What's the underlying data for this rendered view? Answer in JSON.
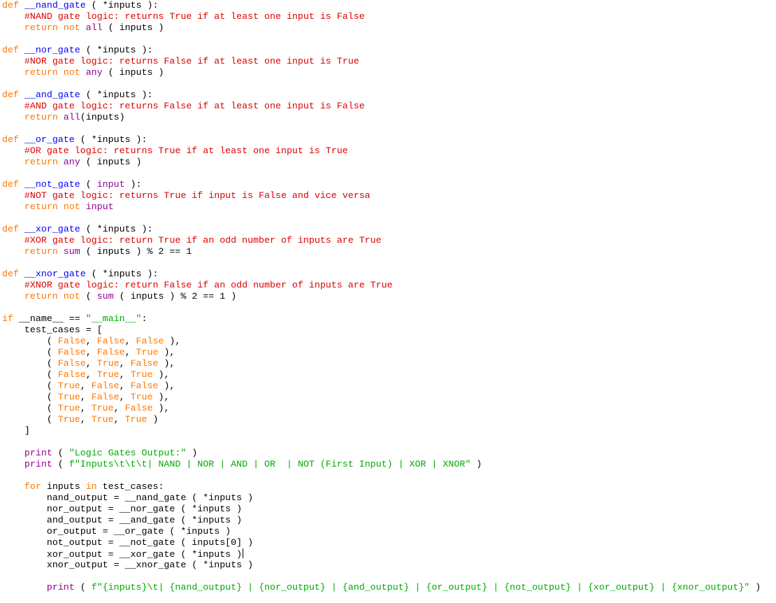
{
  "editor": {
    "language": "python",
    "colors": {
      "keyword": "#ff7700",
      "builtin": "#900090",
      "defname": "#0000ff",
      "comment": "#dd0000",
      "string": "#00aa00",
      "text": "#000000",
      "background": "#ffffff"
    },
    "lines": [
      [
        [
          "keyword",
          "def "
        ],
        [
          "defname",
          "__nand_gate"
        ],
        [
          "plain",
          " ( *inputs ):"
        ]
      ],
      [
        [
          "plain",
          "    "
        ],
        [
          "comment",
          "#NAND gate logic: returns True if at least one input is False"
        ]
      ],
      [
        [
          "plain",
          "    "
        ],
        [
          "keyword",
          "return not "
        ],
        [
          "builtin",
          "all"
        ],
        [
          "plain",
          " ( inputs )"
        ]
      ],
      [],
      [
        [
          "keyword",
          "def "
        ],
        [
          "defname",
          "__nor_gate"
        ],
        [
          "plain",
          " ( *inputs ):"
        ]
      ],
      [
        [
          "plain",
          "    "
        ],
        [
          "comment",
          "#NOR gate logic: returns False if at least one input is True"
        ]
      ],
      [
        [
          "plain",
          "    "
        ],
        [
          "keyword",
          "return not "
        ],
        [
          "builtin",
          "any"
        ],
        [
          "plain",
          " ( inputs )"
        ]
      ],
      [],
      [
        [
          "keyword",
          "def "
        ],
        [
          "defname",
          "__and_gate"
        ],
        [
          "plain",
          " ( *inputs ):"
        ]
      ],
      [
        [
          "plain",
          "    "
        ],
        [
          "comment",
          "#AND gate logic: returns False if at least one input is False"
        ]
      ],
      [
        [
          "plain",
          "    "
        ],
        [
          "keyword",
          "return "
        ],
        [
          "builtin",
          "all"
        ],
        [
          "plain",
          "(inputs)"
        ]
      ],
      [],
      [
        [
          "keyword",
          "def "
        ],
        [
          "defname",
          "__or_gate"
        ],
        [
          "plain",
          " ( *inputs ):"
        ]
      ],
      [
        [
          "plain",
          "    "
        ],
        [
          "comment",
          "#OR gate logic: returns True if at least one input is True"
        ]
      ],
      [
        [
          "plain",
          "    "
        ],
        [
          "keyword",
          "return "
        ],
        [
          "builtin",
          "any"
        ],
        [
          "plain",
          " ( inputs )"
        ]
      ],
      [],
      [
        [
          "keyword",
          "def "
        ],
        [
          "defname",
          "__not_gate"
        ],
        [
          "plain",
          " ( "
        ],
        [
          "builtin",
          "input"
        ],
        [
          "plain",
          " ):"
        ]
      ],
      [
        [
          "plain",
          "    "
        ],
        [
          "comment",
          "#NOT gate logic: returns True if input is False and vice versa"
        ]
      ],
      [
        [
          "plain",
          "    "
        ],
        [
          "keyword",
          "return not "
        ],
        [
          "builtin",
          "input"
        ]
      ],
      [],
      [
        [
          "keyword",
          "def "
        ],
        [
          "defname",
          "__xor_gate"
        ],
        [
          "plain",
          " ( *inputs ):"
        ]
      ],
      [
        [
          "plain",
          "    "
        ],
        [
          "comment",
          "#XOR gate logic: return True if an odd number of inputs are True"
        ]
      ],
      [
        [
          "plain",
          "    "
        ],
        [
          "keyword",
          "return "
        ],
        [
          "builtin",
          "sum"
        ],
        [
          "plain",
          " ( inputs ) % 2 == 1"
        ]
      ],
      [],
      [
        [
          "keyword",
          "def "
        ],
        [
          "defname",
          "__xnor_gate"
        ],
        [
          "plain",
          " ( *inputs ):"
        ]
      ],
      [
        [
          "plain",
          "    "
        ],
        [
          "comment",
          "#XNOR gate logic: return False if an odd number of inputs are True"
        ]
      ],
      [
        [
          "plain",
          "    "
        ],
        [
          "keyword",
          "return not "
        ],
        [
          "plain",
          "( "
        ],
        [
          "builtin",
          "sum"
        ],
        [
          "plain",
          " ( inputs ) % 2 == 1 )"
        ]
      ],
      [],
      [
        [
          "keyword",
          "if "
        ],
        [
          "plain",
          "__name__ == "
        ],
        [
          "string",
          "\"__main__\""
        ],
        [
          "plain",
          ":"
        ]
      ],
      [
        [
          "plain",
          "    test_cases = ["
        ]
      ],
      [
        [
          "plain",
          "        ( "
        ],
        [
          "keyword",
          "False"
        ],
        [
          "plain",
          ", "
        ],
        [
          "keyword",
          "False"
        ],
        [
          "plain",
          ", "
        ],
        [
          "keyword",
          "False"
        ],
        [
          "plain",
          " ),"
        ]
      ],
      [
        [
          "plain",
          "        ( "
        ],
        [
          "keyword",
          "False"
        ],
        [
          "plain",
          ", "
        ],
        [
          "keyword",
          "False"
        ],
        [
          "plain",
          ", "
        ],
        [
          "keyword",
          "True"
        ],
        [
          "plain",
          " ),"
        ]
      ],
      [
        [
          "plain",
          "        ( "
        ],
        [
          "keyword",
          "False"
        ],
        [
          "plain",
          ", "
        ],
        [
          "keyword",
          "True"
        ],
        [
          "plain",
          ", "
        ],
        [
          "keyword",
          "False"
        ],
        [
          "plain",
          " ),"
        ]
      ],
      [
        [
          "plain",
          "        ( "
        ],
        [
          "keyword",
          "False"
        ],
        [
          "plain",
          ", "
        ],
        [
          "keyword",
          "True"
        ],
        [
          "plain",
          ", "
        ],
        [
          "keyword",
          "True"
        ],
        [
          "plain",
          " ),"
        ]
      ],
      [
        [
          "plain",
          "        ( "
        ],
        [
          "keyword",
          "True"
        ],
        [
          "plain",
          ", "
        ],
        [
          "keyword",
          "False"
        ],
        [
          "plain",
          ", "
        ],
        [
          "keyword",
          "False"
        ],
        [
          "plain",
          " ),"
        ]
      ],
      [
        [
          "plain",
          "        ( "
        ],
        [
          "keyword",
          "True"
        ],
        [
          "plain",
          ", "
        ],
        [
          "keyword",
          "False"
        ],
        [
          "plain",
          ", "
        ],
        [
          "keyword",
          "True"
        ],
        [
          "plain",
          " ),"
        ]
      ],
      [
        [
          "plain",
          "        ( "
        ],
        [
          "keyword",
          "True"
        ],
        [
          "plain",
          ", "
        ],
        [
          "keyword",
          "True"
        ],
        [
          "plain",
          ", "
        ],
        [
          "keyword",
          "False"
        ],
        [
          "plain",
          " ),"
        ]
      ],
      [
        [
          "plain",
          "        ( "
        ],
        [
          "keyword",
          "True"
        ],
        [
          "plain",
          ", "
        ],
        [
          "keyword",
          "True"
        ],
        [
          "plain",
          ", "
        ],
        [
          "keyword",
          "True"
        ],
        [
          "plain",
          " )"
        ]
      ],
      [
        [
          "plain",
          "    ]"
        ]
      ],
      [],
      [
        [
          "plain",
          "    "
        ],
        [
          "builtin",
          "print"
        ],
        [
          "plain",
          " ( "
        ],
        [
          "string",
          "\"Logic Gates Output:\""
        ],
        [
          "plain",
          " )"
        ]
      ],
      [
        [
          "plain",
          "    "
        ],
        [
          "builtin",
          "print"
        ],
        [
          "plain",
          " ( "
        ],
        [
          "string",
          "f\"Inputs\\t\\t\\t| NAND | NOR | AND | OR  | NOT (First Input) | XOR | XNOR\""
        ],
        [
          "plain",
          " )"
        ]
      ],
      [],
      [
        [
          "plain",
          "    "
        ],
        [
          "keyword",
          "for "
        ],
        [
          "plain",
          "inputs "
        ],
        [
          "keyword",
          "in "
        ],
        [
          "plain",
          "test_cases:"
        ]
      ],
      [
        [
          "plain",
          "        nand_output = __nand_gate ( *inputs )"
        ]
      ],
      [
        [
          "plain",
          "        nor_output = __nor_gate ( *inputs )"
        ]
      ],
      [
        [
          "plain",
          "        and_output = __and_gate ( *inputs )"
        ]
      ],
      [
        [
          "plain",
          "        or_output = __or_gate ( *inputs )"
        ]
      ],
      [
        [
          "plain",
          "        not_output = __not_gate ( inputs[0] )"
        ]
      ],
      [
        [
          "plain",
          "        xor_output = __xor_gate ( *inputs )"
        ]
      ],
      [
        [
          "plain",
          "        xnor_output = __xnor_gate ( *inputs )"
        ]
      ],
      [],
      [
        [
          "plain",
          "        "
        ],
        [
          "builtin",
          "print"
        ],
        [
          "plain",
          " ( "
        ],
        [
          "string",
          "f\"{inputs}\\t| {nand_output} | {nor_output} | {and_output} | {or_output} | {not_output} | {xor_output} | {xnor_output}\""
        ],
        [
          "plain",
          " )"
        ]
      ]
    ],
    "caret_line": 49
  }
}
